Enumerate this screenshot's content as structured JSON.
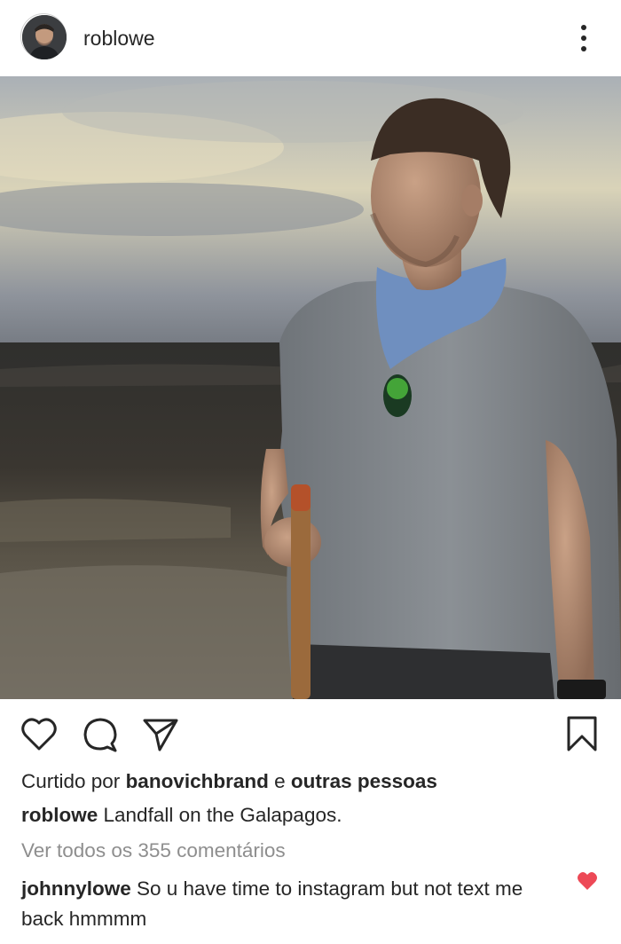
{
  "header": {
    "username": "roblowe",
    "avatar_icon": "profile-avatar",
    "more_icon": "vertical-dots-icon"
  },
  "photo": {
    "subject": "man on hillside at dusk"
  },
  "actions": {
    "like_icon": "heart-outline-icon",
    "comment_icon": "comment-bubble-icon",
    "share_icon": "paper-plane-icon",
    "save_icon": "bookmark-icon"
  },
  "likes": {
    "prefix": "Curtido por ",
    "user": "banovichbrand",
    "joiner": " e ",
    "others": "outras pessoas"
  },
  "caption": {
    "user": "roblowe",
    "text": " Landfall on the Galapagos."
  },
  "view_comments": "Ver todos os 355 comentários",
  "comment": {
    "user": "johnnylowe",
    "text": " So u have time to instagram but not text me back hmmmm",
    "liked_color": "#ed4956"
  }
}
